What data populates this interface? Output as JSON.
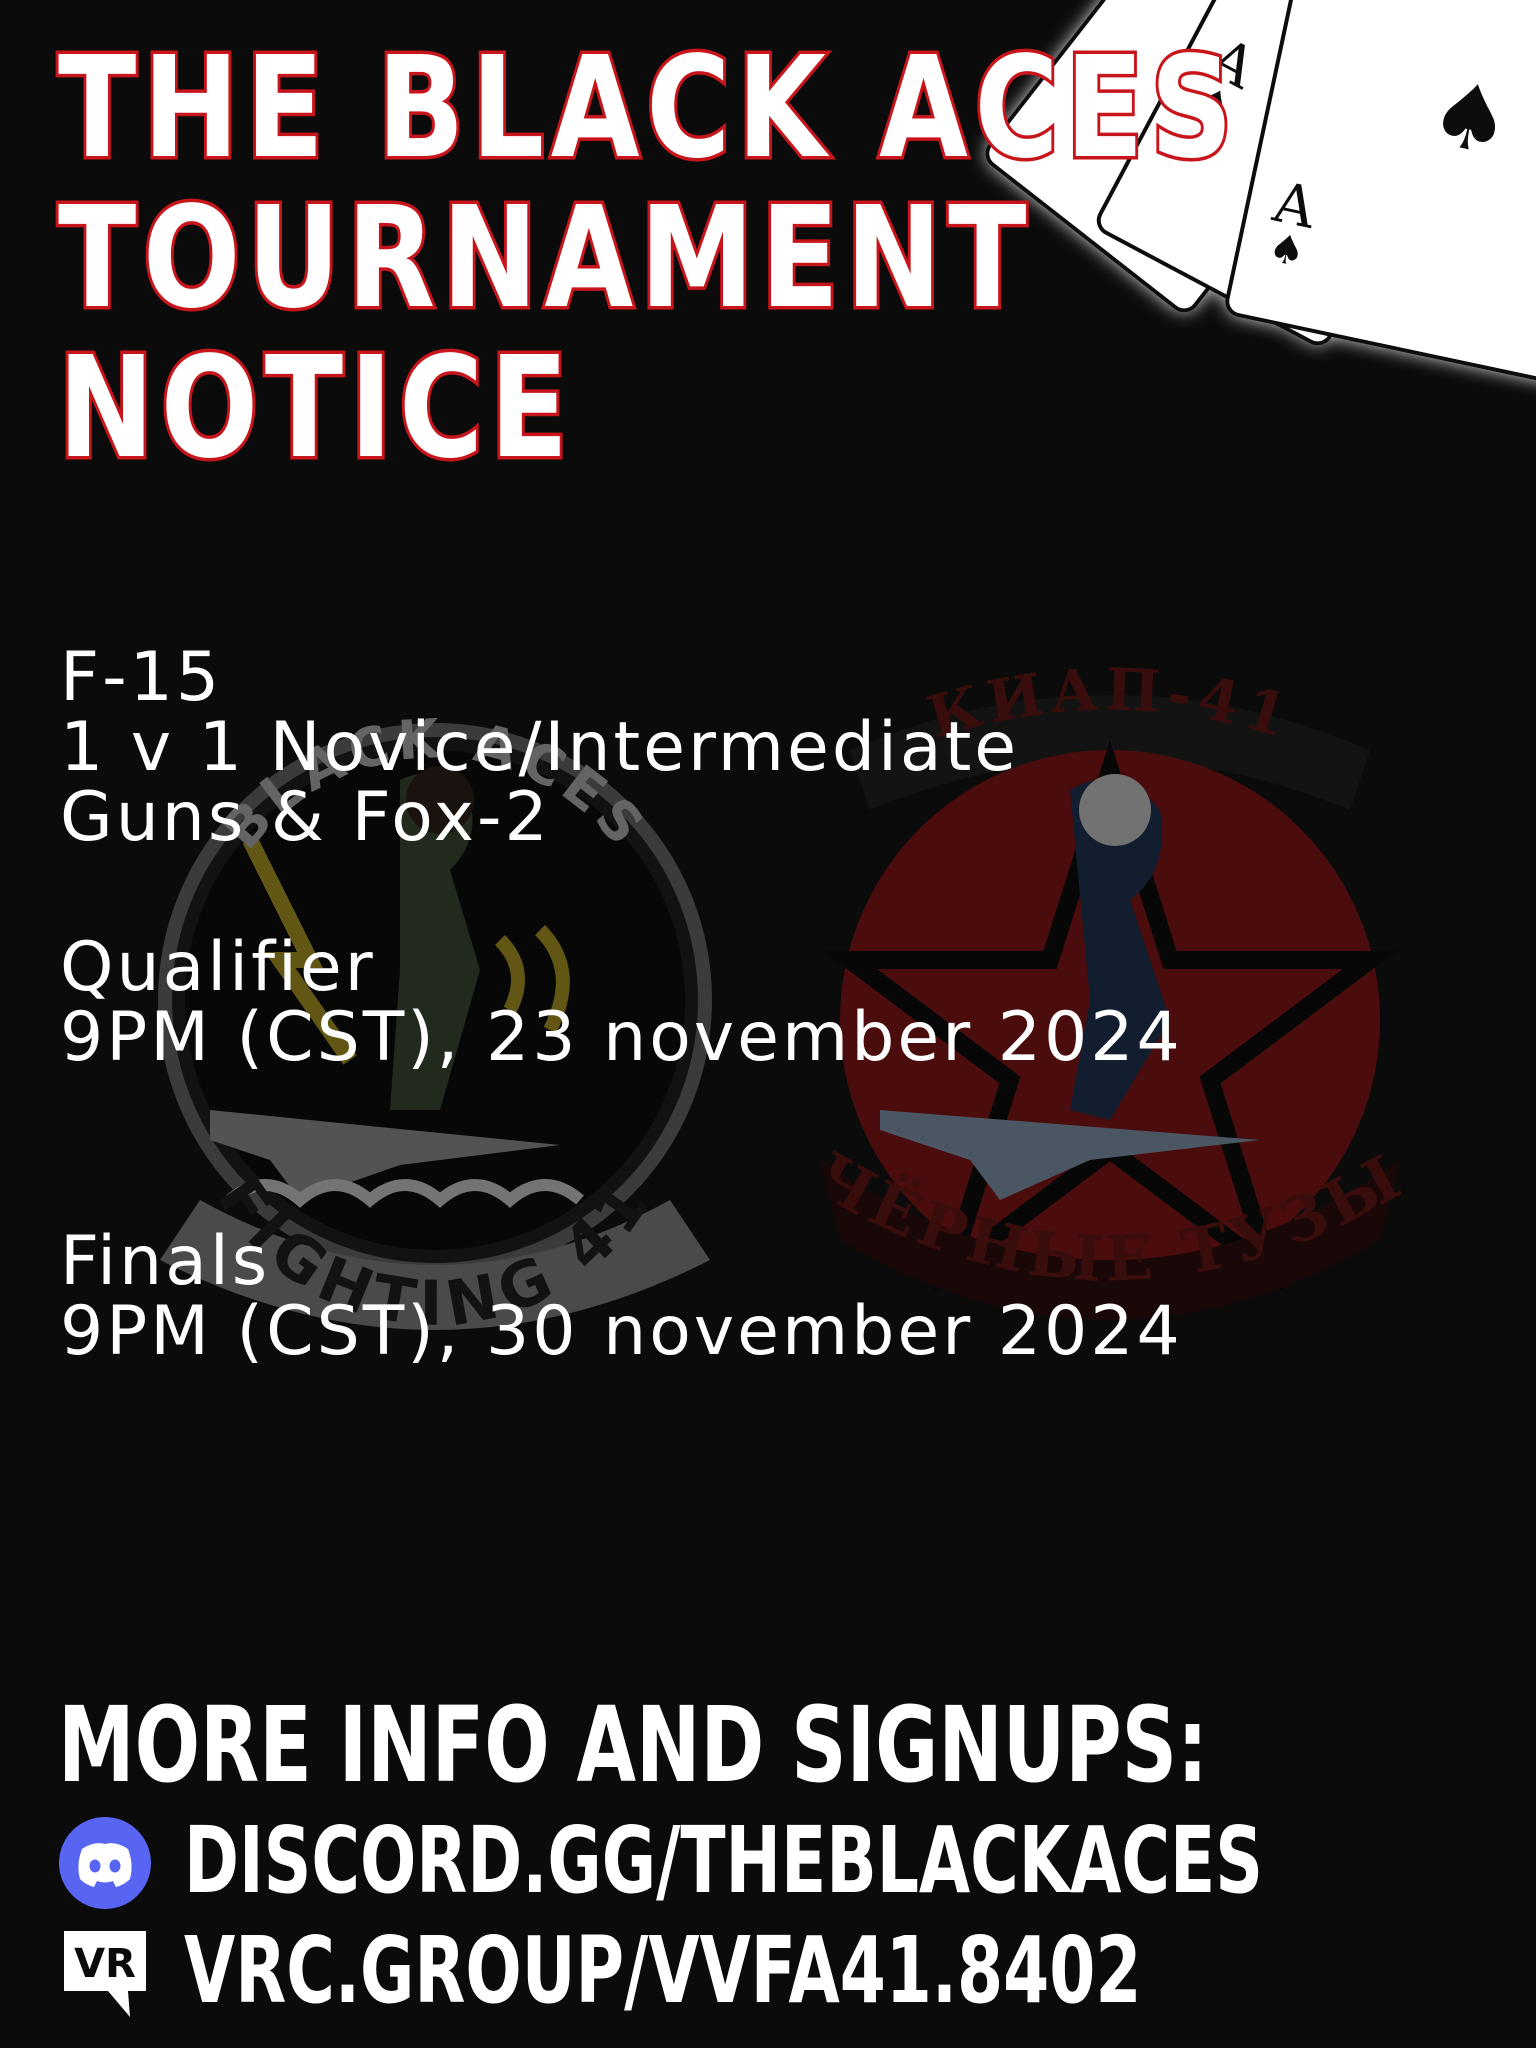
{
  "title": {
    "line1": "THE BLACK ACES",
    "line2": "TOURNAMENT",
    "line3": "NOTICE"
  },
  "event": {
    "aircraft": "F-15",
    "format": "1 v 1 Novice/Intermediate",
    "weapons": "Guns & Fox-2",
    "qualifier_label": "Qualifier",
    "qualifier_time": "9PM (CST), 23 november 2024",
    "finals_label": "Finals",
    "finals_time": "9PM (CST), 30 november 2024"
  },
  "emblems": {
    "left_top_text": "BLACK ACES",
    "left_bottom_text": "FIGHTING 41",
    "right_top_text": "КИАП-41",
    "right_bottom_text": "ЧЁРНЫЕ ТУЗЫ"
  },
  "footer": {
    "heading": "MORE INFO AND SIGNUPS:",
    "discord_link": "DISCORD.GG/THEBLACKACES",
    "vrc_link": "VRC.GROUP/VVFA41.8402",
    "vr_icon_text": "VR"
  },
  "cards": {
    "rank": "A",
    "suit": "♠"
  },
  "colors": {
    "background": "#0b0b0b",
    "title_outline": "#c8141b",
    "discord": "#5865f2",
    "emblem_red": "#8a0d0d"
  }
}
